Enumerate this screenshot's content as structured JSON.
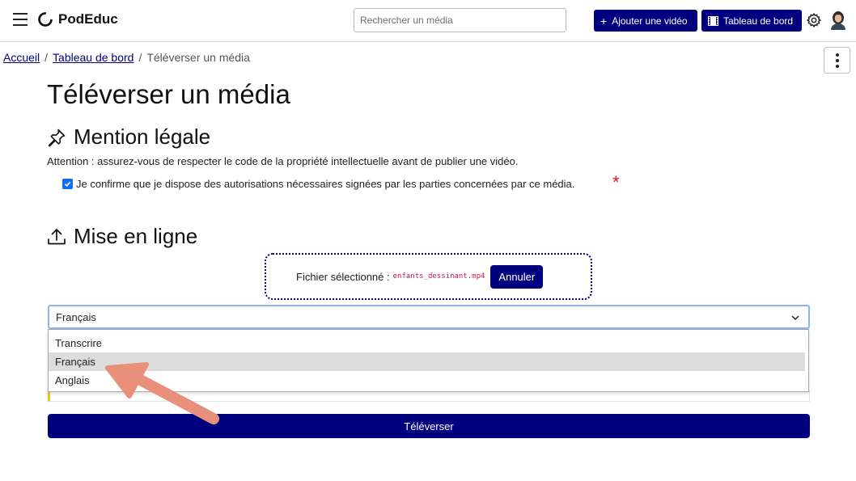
{
  "header": {
    "brand": "PodEduc",
    "search_placeholder": "Rechercher un média",
    "add_video_label": "Ajouter une vidéo",
    "dashboard_label": "Tableau de bord"
  },
  "breadcrumb": {
    "home": "Accueil",
    "separator": "/",
    "dashboard": "Tableau de bord",
    "current": "Téléverser un média"
  },
  "page": {
    "title": "Téléverser un média"
  },
  "legal": {
    "title": "Mention légale",
    "warning": "Attention : assurez-vous de respecter le code de la propriété intellectuelle avant de publier une vidéo.",
    "confirm_label": "Je confirme que je dispose des autorisations nécessaires signées par les parties concernées par ce média.",
    "confirm_checked": true,
    "required_mark": "*"
  },
  "upload": {
    "title": "Mise en ligne",
    "file_label": "Fichier sélectionné :",
    "file_name": "enfants_dessinant.mp4",
    "cancel_label": "Annuler",
    "language_value": "Français",
    "language_options": [
      "Transcrire",
      "Français",
      "Anglais"
    ],
    "highlighted_option": "Français",
    "submit_label": "Téléverser"
  },
  "colors": {
    "primary": "#00007f",
    "required": "#d71921",
    "file_name": "#c2185b",
    "annotation_arrow": "#e8907a"
  }
}
